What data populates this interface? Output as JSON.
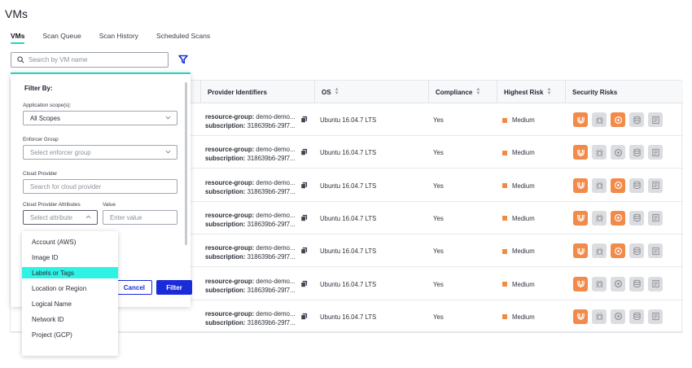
{
  "page": {
    "title": "VMs"
  },
  "tabs": [
    {
      "label": "VMs",
      "active": true
    },
    {
      "label": "Scan Queue",
      "active": false
    },
    {
      "label": "Scan History",
      "active": false
    },
    {
      "label": "Scheduled Scans",
      "active": false
    }
  ],
  "search": {
    "placeholder": "Search by VM name",
    "value": ""
  },
  "table": {
    "columns": [
      "Provider Identifiers",
      "OS",
      "Compliance",
      "Highest Risk",
      "Security Risks"
    ],
    "rows": [
      {
        "rg_label": "resource-group:",
        "rg_value": "demo-demo...",
        "sub_label": "subscription:",
        "sub_value": "318639b6-29f7...",
        "os": "Ubuntu 16.04.7 LTS",
        "compliance": "Yes",
        "risk": "Medium"
      },
      {
        "rg_label": "resource-group:",
        "rg_value": "demo-demo...",
        "sub_label": "subscription:",
        "sub_value": "318639b6-29f7...",
        "os": "Ubuntu 16.04.7 LTS",
        "compliance": "Yes",
        "risk": "Medium"
      },
      {
        "rg_label": "resource-group:",
        "rg_value": "demo-demo...",
        "sub_label": "subscription:",
        "sub_value": "318639b6-29f7...",
        "os": "Ubuntu 16.04.7 LTS",
        "compliance": "Yes",
        "risk": "Medium"
      },
      {
        "rg_label": "resource-group:",
        "rg_value": "demo-demo...",
        "sub_label": "subscription:",
        "sub_value": "318639b6-29f7...",
        "os": "Ubuntu 16.04.7 LTS",
        "compliance": "Yes",
        "risk": "Medium"
      },
      {
        "rg_label": "resource-group:",
        "rg_value": "demo-demo...",
        "sub_label": "subscription:",
        "sub_value": "318639b6-29f7...",
        "os": "Ubuntu 16.04.7 LTS",
        "compliance": "Yes",
        "risk": "Medium"
      },
      {
        "rg_label": "resource-group:",
        "rg_value": "demo-demo...",
        "sub_label": "subscription:",
        "sub_value": "318639b6-29f7...",
        "os": "Ubuntu 16.04.7 LTS",
        "compliance": "Yes",
        "risk": "Medium"
      },
      {
        "rg_label": "resource-group:",
        "rg_value": "demo-demo...",
        "sub_label": "subscription:",
        "sub_value": "318639b6-29f7...",
        "os": "Ubuntu 16.04.7 LTS",
        "compliance": "Yes",
        "risk": "Medium"
      }
    ],
    "security_icons": [
      "vulnerability-icon",
      "bug-icon",
      "malware-icon",
      "database-icon",
      "document-icon"
    ],
    "security_active": [
      [
        true,
        false,
        true,
        false,
        false
      ],
      [
        true,
        false,
        false,
        false,
        false
      ],
      [
        true,
        false,
        true,
        false,
        false
      ],
      [
        true,
        false,
        true,
        false,
        false
      ],
      [
        true,
        false,
        true,
        false,
        false
      ],
      [
        true,
        false,
        false,
        false,
        false
      ],
      [
        true,
        false,
        false,
        false,
        false
      ]
    ]
  },
  "filter_panel": {
    "title": "Filter By:",
    "app_scope_label": "Application scope(s):",
    "app_scope_value": "All Scopes",
    "enforcer_group_label": "Enforcer Group",
    "enforcer_group_placeholder": "Select enforcer group",
    "cloud_provider_label": "Cloud Provider",
    "cloud_provider_placeholder": "Search for cloud provider",
    "attributes_label": "Cloud Provider Attributes",
    "value_label": "Value",
    "attribute_placeholder": "Select attribute",
    "value_placeholder": "Enter value",
    "cancel_label": "Cancel",
    "filter_label": "Filter"
  },
  "attribute_options": [
    {
      "label": "Account (AWS)",
      "highlighted": false
    },
    {
      "label": "Image ID",
      "highlighted": false
    },
    {
      "label": "Labels or Tags",
      "highlighted": true
    },
    {
      "label": "Location or Region",
      "highlighted": false
    },
    {
      "label": "Logical Name",
      "highlighted": false
    },
    {
      "label": "Network ID",
      "highlighted": false
    },
    {
      "label": "Project (GCP)",
      "highlighted": false
    }
  ],
  "colors": {
    "accent_teal": "#22d3c5",
    "primary_blue": "#1a2bd8",
    "risk_orange": "#f08a45",
    "dropdown_highlight": "#2ef3e4"
  }
}
